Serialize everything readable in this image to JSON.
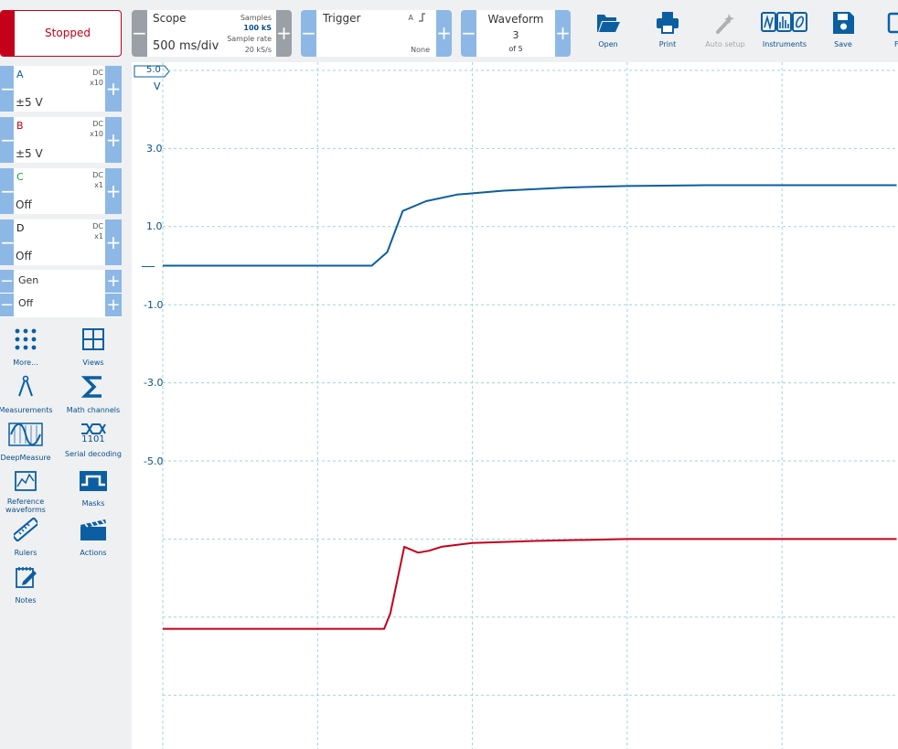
{
  "run_status": "Stopped",
  "scope": {
    "title": "Scope",
    "timebase": "500 ms/div",
    "samples_label": "Samples",
    "samples_value": "100 kS",
    "rate_label": "Sample rate",
    "rate_value": "20 kS/s"
  },
  "trigger": {
    "title": "Trigger",
    "source": "A",
    "mode": "None"
  },
  "waveform": {
    "title": "Waveform",
    "current": "3",
    "total": "of 5"
  },
  "toolbar": {
    "open": "Open",
    "print": "Print",
    "auto_setup": "Auto setup",
    "instruments": "Instruments",
    "save": "Save",
    "more": "F"
  },
  "channels": [
    {
      "name": "A",
      "coupling": "DC",
      "probe": "x10",
      "range": "±5 V",
      "color": "#0b5fa0"
    },
    {
      "name": "B",
      "coupling": "DC",
      "probe": "x10",
      "range": "±5 V",
      "color": "#c4001a"
    },
    {
      "name": "C",
      "coupling": "DC",
      "probe": "x1",
      "range": "Off",
      "color": "#1f9d3a"
    },
    {
      "name": "D",
      "coupling": "DC",
      "probe": "x1",
      "range": "Off",
      "color": "#111111"
    }
  ],
  "generator": {
    "name": "Gen",
    "state": "Off"
  },
  "tools": {
    "more": "More...",
    "views": "Views",
    "measurements": "Measurements",
    "math_channels": "Math channels",
    "deepmeasure": "DeepMeasure",
    "serial_decoding": "Serial decoding",
    "serial_code": "1101",
    "reference_waveforms": "Reference waveforms",
    "masks": "Masks",
    "rulers": "Rulers",
    "actions": "Actions",
    "notes": "Notes"
  },
  "axis": {
    "top_value": "5.0",
    "unit": "V",
    "ticks": [
      "3.0",
      "1.0",
      "-1.0",
      "-3.0",
      "-5.0"
    ]
  },
  "chart_data": {
    "type": "line",
    "x_unit": "ms",
    "ylim": [
      -5,
      5
    ],
    "grid": true,
    "series": [
      {
        "color": "#0b5fa0",
        "x": [
          0,
          1350,
          1450,
          1550,
          1700,
          1900,
          2200,
          2600,
          3000,
          3500,
          4000,
          4740
        ],
        "y": [
          0,
          0,
          0.35,
          1.4,
          1.65,
          1.82,
          1.92,
          2.0,
          2.04,
          2.06,
          2.06,
          2.06
        ]
      },
      {
        "color": "#c4001a",
        "x": [
          0,
          1430,
          1470,
          1560,
          1650,
          1720,
          1800,
          2000,
          2400,
          3000,
          3500,
          4000,
          4740
        ],
        "y": [
          -9.3,
          -9.3,
          -8.9,
          -7.2,
          -7.35,
          -7.3,
          -7.2,
          -7.1,
          -7.05,
          -7.0,
          -7.0,
          -7.0,
          -7.0
        ]
      }
    ]
  }
}
